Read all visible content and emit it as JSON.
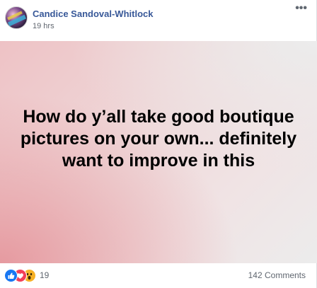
{
  "post": {
    "author": "Candice Sandoval-Whitlock",
    "timestamp": "19 hrs",
    "more_icon": "•••",
    "text": "How do y’all take good boutique pictures on your own... definitely want to improve in this"
  },
  "reactions": {
    "types": [
      "like-icon",
      "love-icon",
      "wow-icon"
    ],
    "count": "19"
  },
  "comments": {
    "label": "142 Comments"
  },
  "colors": {
    "author_link": "#385898",
    "meta_text": "#616770",
    "like": "#1877f2",
    "love": "#f33e58",
    "wow": "#f7b125"
  }
}
